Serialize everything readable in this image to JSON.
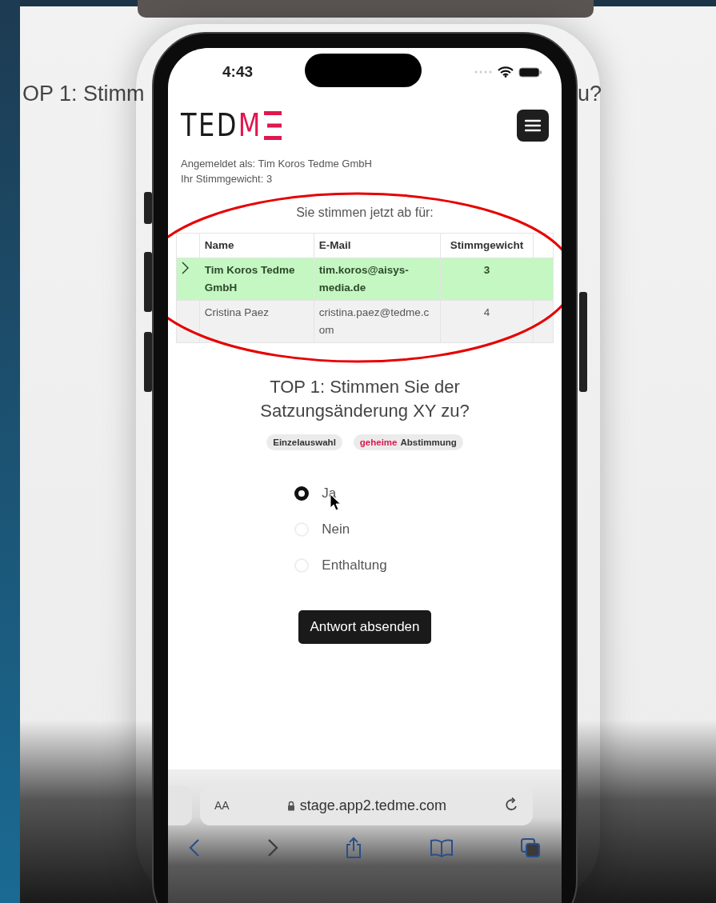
{
  "backdrop": {
    "left_text": "OP 1: Stimm",
    "right_text": "u?"
  },
  "status_bar": {
    "time": "4:43"
  },
  "header": {
    "logo_text": "TED",
    "logo_accent": "M"
  },
  "session": {
    "logged_in_as": "Angemeldet als: Tim Koros Tedme GmbH",
    "vote_weight": "Ihr Stimmgewicht: 3"
  },
  "proxy_table": {
    "heading": "Sie stimmen jetzt ab für:",
    "columns": [
      "Name",
      "E-Mail",
      "Stimmgewicht"
    ],
    "rows": [
      {
        "name": "Tim Koros Tedme GmbH",
        "email": "tim.koros@aisys-media.de",
        "weight": "3",
        "selected": true
      },
      {
        "name": "Cristina Paez",
        "email": "cristina.paez@tedme.com",
        "weight": "4",
        "selected": false
      }
    ]
  },
  "question": {
    "title": "TOP 1: Stimmen Sie der Satzungsänderung XY zu?",
    "tags": [
      {
        "text": "Einzelauswahl"
      },
      {
        "accent": "geheime",
        "text": "Abstimmung"
      }
    ],
    "options": [
      {
        "label": "Ja",
        "selected": true
      },
      {
        "label": "Nein",
        "selected": false
      },
      {
        "label": "Enthaltung",
        "selected": false
      }
    ],
    "submit": "Antwort absenden"
  },
  "browser": {
    "text_size": "AA",
    "url": "stage.app2.tedme.com"
  }
}
